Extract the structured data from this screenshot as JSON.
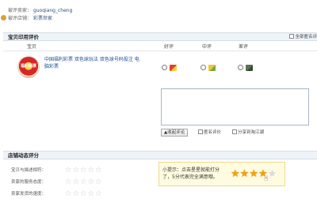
{
  "seller": {
    "seller_label": "被评卖家：",
    "seller_name": "guoqiang_cheng",
    "store_label": "被评店铺：",
    "store_name": "彩票世家"
  },
  "item_section": {
    "title": "宝贝印用评价",
    "anonymous_all_label": "全部匿名评"
  },
  "columns": {
    "item": "宝贝",
    "good": "好评",
    "neutral": "中评",
    "bad": "差评"
  },
  "product": {
    "image_text": "福利彩票",
    "name": "中国福利彩票 双色球玩法 双色球号码投注 电脑彩票"
  },
  "comment": {
    "value": "",
    "fold_label": "▲收起评论",
    "anonymous_label": "匿名评价",
    "share_label": "分享到淘江湖"
  },
  "store_section": {
    "title": "店铺动态评分",
    "rows": [
      {
        "label": "宝贝与描述相符："
      },
      {
        "label": "卖家的服务态度："
      },
      {
        "label": "卖家发货的速度："
      }
    ],
    "empty_stars": "☆☆☆☆☆",
    "tip": "小提示：点击星星就能打分了，5分代表完全满意哦。",
    "tip_rating": 4,
    "tip_stars_total": 5
  },
  "colors": {
    "link": "#1b4e92",
    "star": "#f1a20d",
    "bar": "#eef3f8"
  }
}
